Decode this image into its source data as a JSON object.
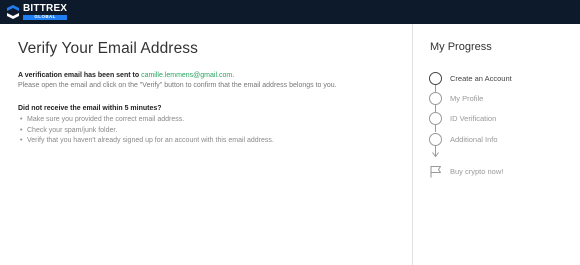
{
  "brand": {
    "name": "BITTREX",
    "sub": "GLOBAL",
    "colors": {
      "topbar": "#0d1a2b",
      "accent": "#1f7ef2",
      "email": "#27a35f"
    }
  },
  "main": {
    "title": "Verify Your Email Address",
    "sent_prefix": "A verification email has been sent to",
    "email": "camille.lemmens@gmail.com",
    "sent_suffix": ".",
    "instruction": "Please open the email and click on the \"Verify\" button to confirm that the email address belongs to you.",
    "not_received_heading": "Did not receive the email within 5 minutes?",
    "tips": [
      "Make sure you provided the correct email address.",
      "Check your spam/junk folder.",
      "Verify that you haven't already signed up for an account with this email address."
    ]
  },
  "progress": {
    "title": "My Progress",
    "steps": [
      {
        "label": "Create an Account",
        "active": true,
        "icon": "circle-icon"
      },
      {
        "label": "My Profile",
        "active": false,
        "icon": "circle-icon"
      },
      {
        "label": "ID Verification",
        "active": false,
        "icon": "circle-icon"
      },
      {
        "label": "Additional Info",
        "active": false,
        "icon": "circle-icon"
      },
      {
        "label": "Buy crypto now!",
        "active": false,
        "icon": "flag-icon"
      }
    ]
  }
}
